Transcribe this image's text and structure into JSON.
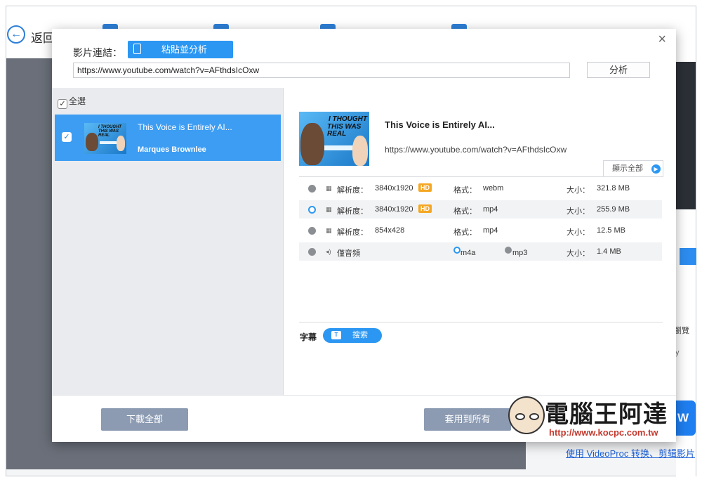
{
  "background_app": {
    "back_label": "返回",
    "right_partial_text": "瀏覽",
    "right_partial_y": "y",
    "partial_button": "W",
    "footer_link": "使用 VideoProc 转换、剪辑影片"
  },
  "dialog": {
    "close": "×",
    "url_label": "影片連結：",
    "paste_button": "粘貼並分析",
    "url_value": "https://www.youtube.com/watch?v=AFthdsIcOxw",
    "analyze_button": "分析",
    "select_all": "全選",
    "items": [
      {
        "title": "This Voice is Entirely AI...",
        "author": "Marques Brownlee",
        "checked": true,
        "thumb_caption": "I THOUGHT THIS WAS REAL"
      }
    ],
    "detail": {
      "title": "This Voice is Entirely AI...",
      "url": "https://www.youtube.com/watch?v=AFthdsIcOxw",
      "thumb_caption_1": "I THOUGHT",
      "thumb_caption_2": "THIS WAS REAL",
      "show_all": "顯示全部"
    },
    "formats": [
      {
        "type_icon": "film-icon",
        "label": "解析度：",
        "resolution": "3840x1920",
        "hd": "HD",
        "format_label": "格式：",
        "format": "webm",
        "size_label": "大小：",
        "size": "321.8 MB",
        "selected": false
      },
      {
        "type_icon": "film-icon",
        "label": "解析度：",
        "resolution": "3840x1920",
        "hd": "HD",
        "format_label": "格式：",
        "format": "mp4",
        "size_label": "大小：",
        "size": "255.9 MB",
        "selected": true
      },
      {
        "type_icon": "film-icon",
        "label": "解析度：",
        "resolution": "854x428",
        "format_label": "格式：",
        "format": "mp4",
        "size_label": "大小：",
        "size": "12.5 MB",
        "selected": false
      }
    ],
    "audio": {
      "type_icon": "speaker-icon",
      "label": "僅音頻",
      "options": [
        "m4a",
        "mp3"
      ],
      "selected_option": "m4a",
      "size_label": "大小：",
      "size": "1.4 MB"
    },
    "subtitle_label": "字幕",
    "search_button": "搜索",
    "download_all": "下載全部",
    "apply_all": "套用到所有"
  },
  "watermark": {
    "text": "電腦王阿達",
    "url": "http://www.kocpc.com.tw"
  },
  "colors": {
    "accent": "#2b97f2",
    "selected_item": "#3d9df3",
    "hd_badge": "#f5a623",
    "footer_buttons": "#8c9bb2"
  }
}
